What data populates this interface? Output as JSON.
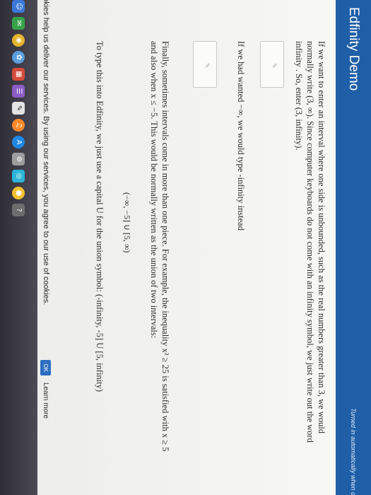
{
  "header": {
    "title": "Edfinity Demo",
    "status": "Turned in automatically when du"
  },
  "content": {
    "paragraph1": "If we want to enter an interval where one side is unbounded, such as the real numbers greater than 3, we would normally write (3, ∞). Since computer keyboards do not come with an infinity symbol, we just write out the word infinity . So, enter (3, infinity).",
    "paragraph2": "If we had wanted −∞, we would type -infinity instead",
    "paragraph3": "Finally, sometimes intervals come in more than one piece. For example, the inequality x² ≥ 25 is satisfied with x ≥ 5 and also when x ≤ −5. This would be normally written as the union of two intervals:",
    "formula": "(−∞, −5] ∪ [5, ∞)",
    "paragraph4": "To type this into Edfinity, we just use a capital U for the union symbol: (-infinity, -5] U [5, infinity)"
  },
  "cookie_bar": {
    "text": "okies help us deliver our services. By using our services, you agree to our use of cookies.",
    "ok_label": "OK",
    "learn_more": "Learn more"
  },
  "dock": {
    "apps": [
      "finder-icon",
      "messages-icon",
      "maps-icon",
      "photos-icon",
      "calendar-icon",
      "reminders-icon",
      "notes-icon",
      "music-icon",
      "app-store-icon",
      "system-preferences-icon",
      "chrome-icon",
      "photo-booth-icon",
      "other-app-icon"
    ]
  }
}
